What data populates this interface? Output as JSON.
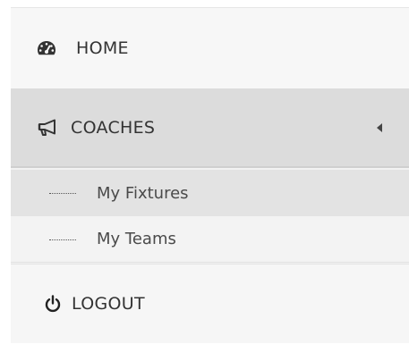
{
  "sidebar": {
    "items": [
      {
        "label": "HOME",
        "icon": "dashboard-icon"
      },
      {
        "label": "COACHES",
        "icon": "bullhorn-icon",
        "expanded": true,
        "children": [
          {
            "label": "My Fixtures",
            "active": true
          },
          {
            "label": "My Teams",
            "active": false
          }
        ]
      },
      {
        "label": "LOGOUT",
        "icon": "power-icon"
      }
    ]
  },
  "colors": {
    "active_bg": "#dcdcdc",
    "submenu_bg": "#f1f1f1",
    "text": "#333333"
  }
}
